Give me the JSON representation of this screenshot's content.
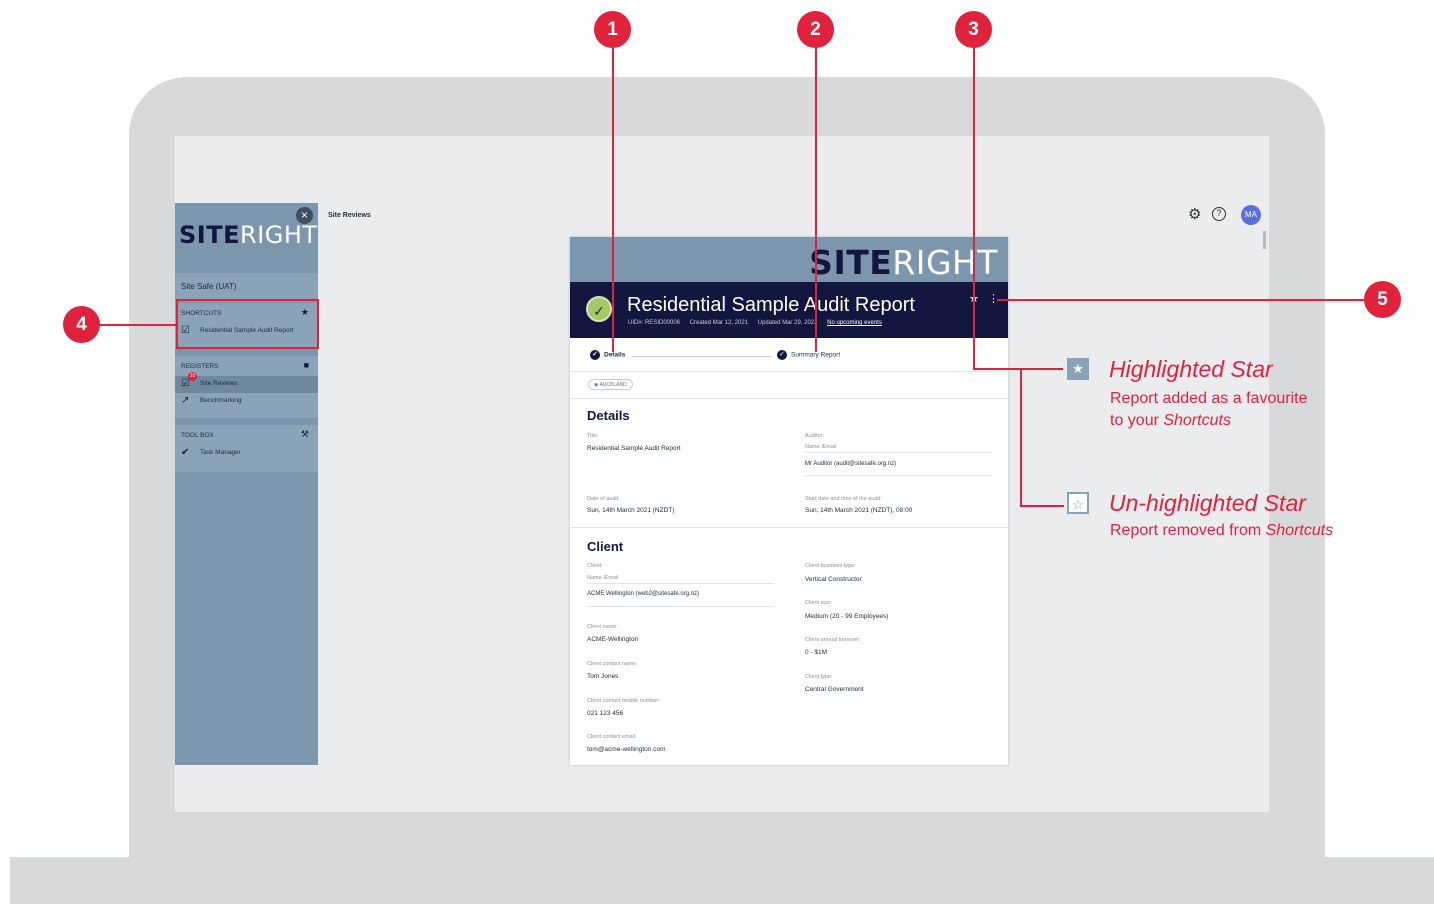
{
  "sidebar": {
    "org": "Site Safe (UAT)",
    "logo_bold": "SITE",
    "logo_light": "RIGHT",
    "shortcuts": {
      "title": "SHORTCUTS",
      "items": [
        {
          "label": "Residential Sample Audit Report",
          "icon": "checkbox-icon"
        }
      ]
    },
    "registers": {
      "title": "REGISTERS",
      "items": [
        {
          "label": "Site Reviews",
          "badge": "10",
          "icon": "checkbox-icon"
        },
        {
          "label": "Benchmarking",
          "icon": "trend-icon"
        }
      ]
    },
    "toolbox": {
      "title": "TOOL BOX",
      "items": [
        {
          "label": "Task Manager",
          "icon": "check-icon"
        }
      ]
    }
  },
  "breadcrumb": "Site Reviews",
  "avatar": "MA",
  "report": {
    "logo_bold": "SITE",
    "logo_light": "RIGHT",
    "title": "Residential Sample Audit Report",
    "meta": {
      "uid": "UID#: RESID00006",
      "created": "Created Mar 12, 2021",
      "updated": "Updated Mar 29, 2021",
      "events": "No upcoming events"
    },
    "steps": [
      "Details",
      "Summary Report"
    ],
    "tag": "AUCKLAND",
    "details": {
      "heading": "Details",
      "title_label": "Title:",
      "title_value": "Residential Sample Audit Report",
      "auditor_label": "Auditor:",
      "auditor_sub": "Name /Email",
      "auditor_value": "Mr Auditor (audit@sitesafe.org.nz)",
      "date_label": "Date of audit:",
      "date_value": "Sun, 14th March 2021 (NZDT)",
      "start_label": "Start date and time of the audit:",
      "start_value": "Sun, 14th March 2021 (NZDT), 08:00"
    },
    "client": {
      "heading": "Client",
      "client_label": "Client:",
      "client_sub": "Name /Email",
      "client_value": "ACME Wellington (web2@sitesafe.org.nz)",
      "name_label": "Client name:",
      "name_value": "ACME-Wellington",
      "contact_label": "Client contact name:",
      "contact_value": "Tom Jones",
      "mobile_label": "Client contact mobile number:",
      "mobile_value": "021 123 456",
      "email_label": "Client contact email:",
      "email_value": "tom@acme-wellington.com",
      "btype_label": "Client business type:",
      "btype_value": "Vertical Constructor",
      "size_label": "Client size:",
      "size_value": "Medium (20 - 99 Employees)",
      "turnover_label": "Client annual turnover:",
      "turnover_value": "0 - $1M",
      "type_label": "Client type:",
      "type_value": "Central Government"
    }
  },
  "callouts": [
    "1",
    "2",
    "3",
    "4",
    "5"
  ],
  "legend": {
    "highlighted_title": "Highlighted Star",
    "highlighted_line1": "Report added as a favourite",
    "highlighted_line2_prefix": "to your ",
    "highlighted_line2_em": "Shortcuts",
    "unhighlighted_title": "Un-highlighted Star",
    "unhighlighted_prefix": "Report removed from ",
    "unhighlighted_em": "Shortcuts"
  },
  "colors": {
    "accent": "#e0223d",
    "navy": "#13163f",
    "sidebar": "#7b96ad"
  }
}
